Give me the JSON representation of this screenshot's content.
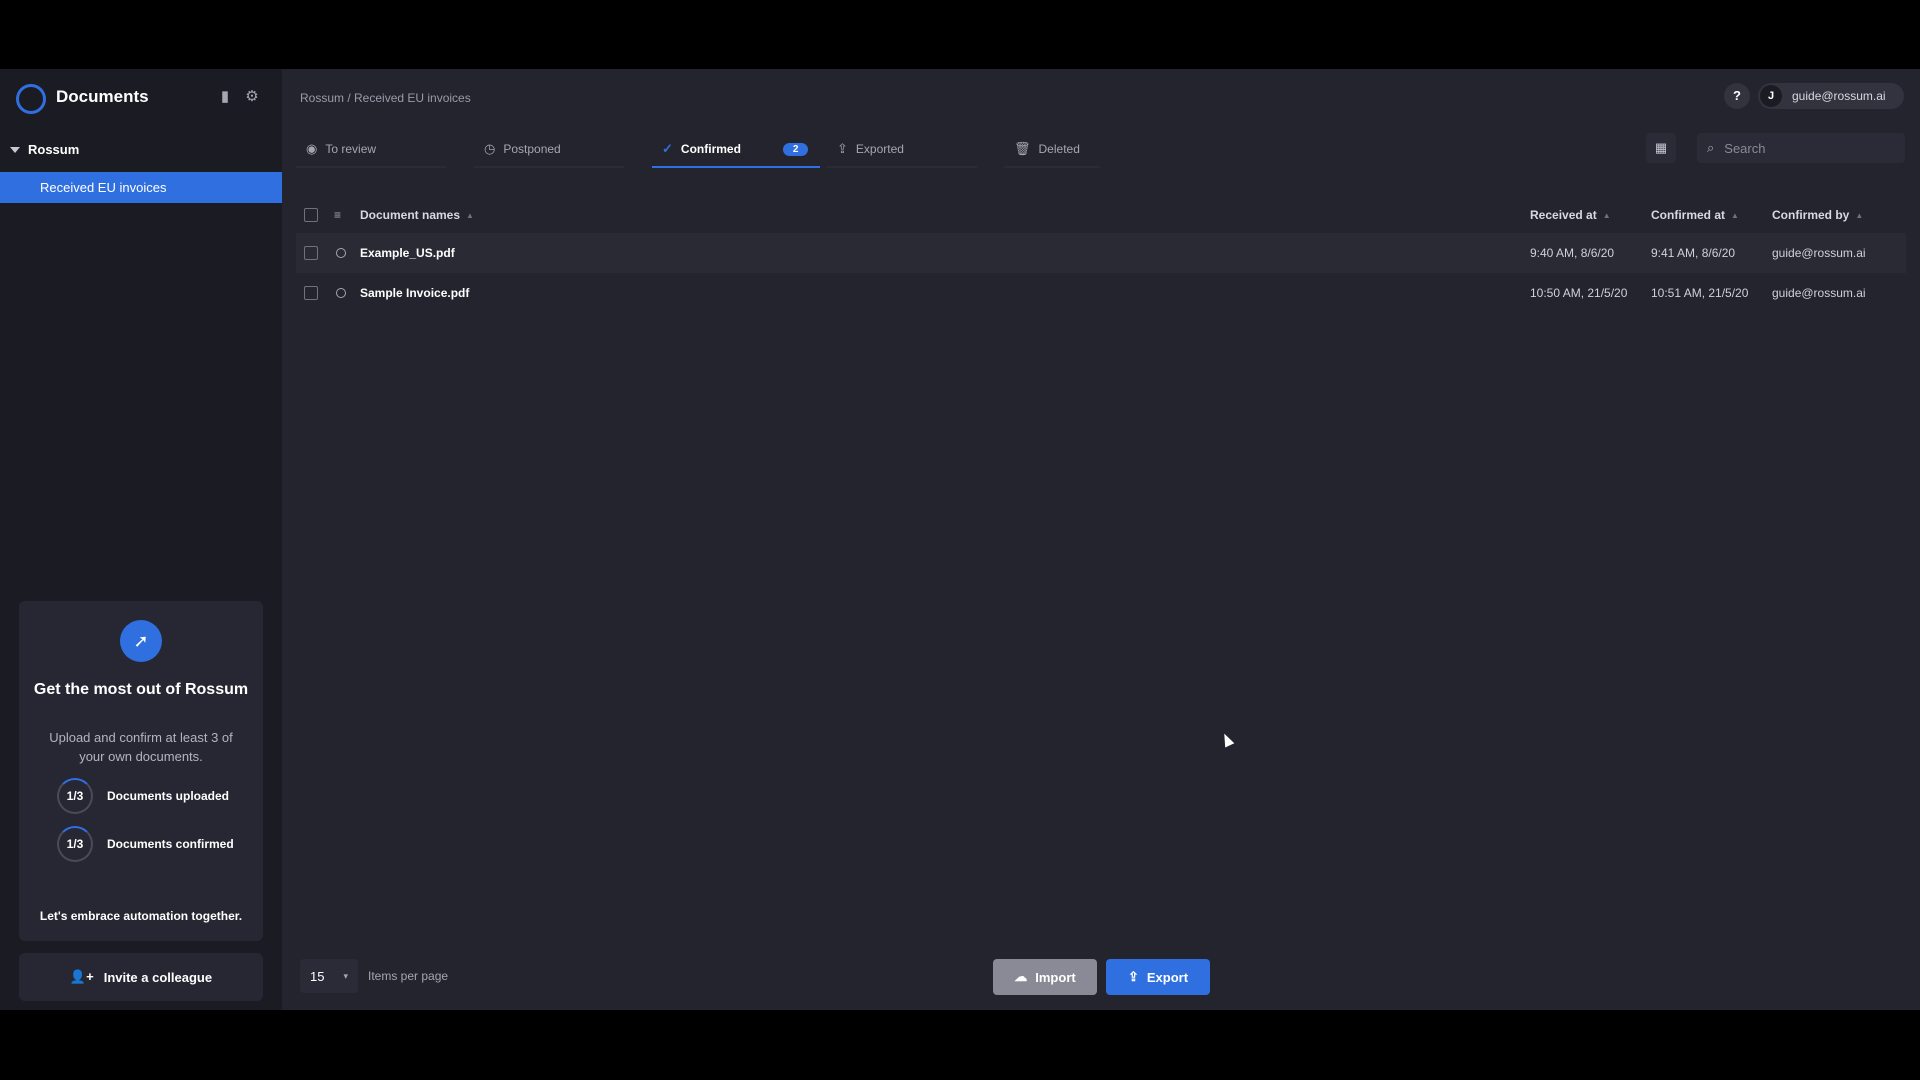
{
  "sidebar": {
    "app_title": "Documents",
    "tree_root": "Rossum",
    "queue": "Received EU invoices",
    "onboarding": {
      "title": "Get the most out of Rossum",
      "text": "Upload and confirm at least 3 of your own documents.",
      "progress": [
        {
          "value": "1/3",
          "label": "Documents uploaded",
          "fraction": 0.33
        },
        {
          "value": "1/3",
          "label": "Documents confirmed",
          "fraction": 0.33
        }
      ],
      "footer": "Let's embrace automation together."
    },
    "invite_label": "Invite a colleague"
  },
  "header": {
    "breadcrumb": "Rossum / Received EU invoices",
    "help": "?",
    "user_initial": "J",
    "user_email": "guide@rossum.ai"
  },
  "tabs": [
    {
      "label": "To review",
      "icon": "eye-icon"
    },
    {
      "label": "Postponed",
      "icon": "clock-icon"
    },
    {
      "label": "Confirmed",
      "icon": "check-icon",
      "count": "2"
    },
    {
      "label": "Exported",
      "icon": "export-icon"
    },
    {
      "label": "Deleted",
      "icon": "trash-icon"
    }
  ],
  "search": {
    "placeholder": "Search"
  },
  "table": {
    "columns": [
      "Document names",
      "Received at",
      "Confirmed at",
      "Confirmed by"
    ],
    "rows": [
      {
        "name": "Example_US.pdf",
        "received": "9:40 AM, 8/6/20",
        "confirmed": "9:41 AM, 8/6/20",
        "by": "guide@rossum.ai"
      },
      {
        "name": "Sample Invoice.pdf",
        "received": "10:50 AM, 21/5/20",
        "confirmed": "10:51 AM, 21/5/20",
        "by": "guide@rossum.ai"
      }
    ]
  },
  "footer": {
    "per_page_value": "15",
    "per_page_label": "Items per page",
    "import_label": "Import",
    "export_label": "Export"
  },
  "colors": {
    "accent": "#2f6fe0",
    "background": "#24242f",
    "sidebar": "#1b1b24"
  }
}
